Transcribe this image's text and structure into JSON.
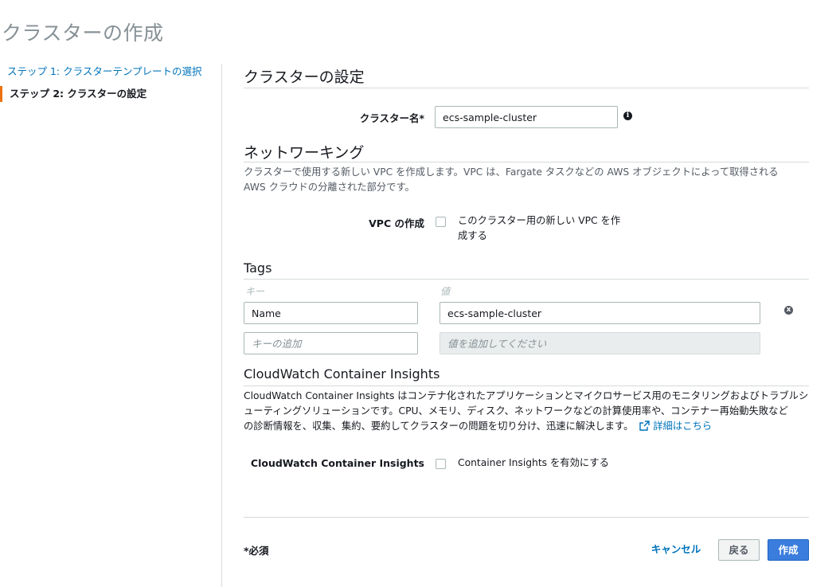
{
  "page": {
    "title": "クラスターの作成"
  },
  "sidebar": {
    "steps": [
      {
        "label": "ステップ 1: クラスターテンプレートの選択"
      },
      {
        "label": "ステップ 2: クラスターの設定"
      }
    ]
  },
  "cluster_config": {
    "title": "クラスターの設定",
    "cluster_name_label": "クラスター名*",
    "cluster_name_value": "ecs-sample-cluster",
    "info_icon": "i"
  },
  "networking": {
    "title": "ネットワーキング",
    "description_line1": "クラスターで使用する新しい VPC を作成します。VPC は、Fargate タスクなどの AWS オブジェクトによって取得される",
    "description_line2": "AWS クラウドの分離された部分です。",
    "vpc_label": "VPC の作成",
    "vpc_checkbox_line1": "このクラスター用の新しい VPC を作",
    "vpc_checkbox_line2": "成する",
    "vpc_checked": false
  },
  "tags": {
    "title": "Tags",
    "key_header": "キー",
    "value_header": "値",
    "rows": [
      {
        "key": "Name",
        "value": "ecs-sample-cluster"
      }
    ],
    "new_key_placeholder": "キーの追加",
    "new_value_placeholder": "値を追加してください",
    "remove_icon": "x"
  },
  "insights": {
    "title": "CloudWatch Container Insights",
    "description_line1": "CloudWatch Container Insights はコンテナ化されたアプリケーションとマイクロサービス用のモニタリングおよびトラブルシ",
    "description_line2": "ューティングソリューションです。CPU、メモリ、ディスク、ネットワークなどの計算使用率や、コンテナー再始動失敗など",
    "description_line3": "の診断情報を、収集、集約、要約してクラスターの問題を切り分け、迅速に解決します。",
    "learn_more": "詳細はこちら",
    "toggle_label": "CloudWatch Container Insights",
    "checkbox_label": "Container Insights を有効にする",
    "checked": false
  },
  "footer": {
    "required_note": "*必須",
    "cancel_label": "キャンセル",
    "back_label": "戻る",
    "create_label": "作成"
  },
  "colors": {
    "accent": "#0073bb",
    "primary_button": "#3b7ddd",
    "step_marker": "#ec7211"
  }
}
